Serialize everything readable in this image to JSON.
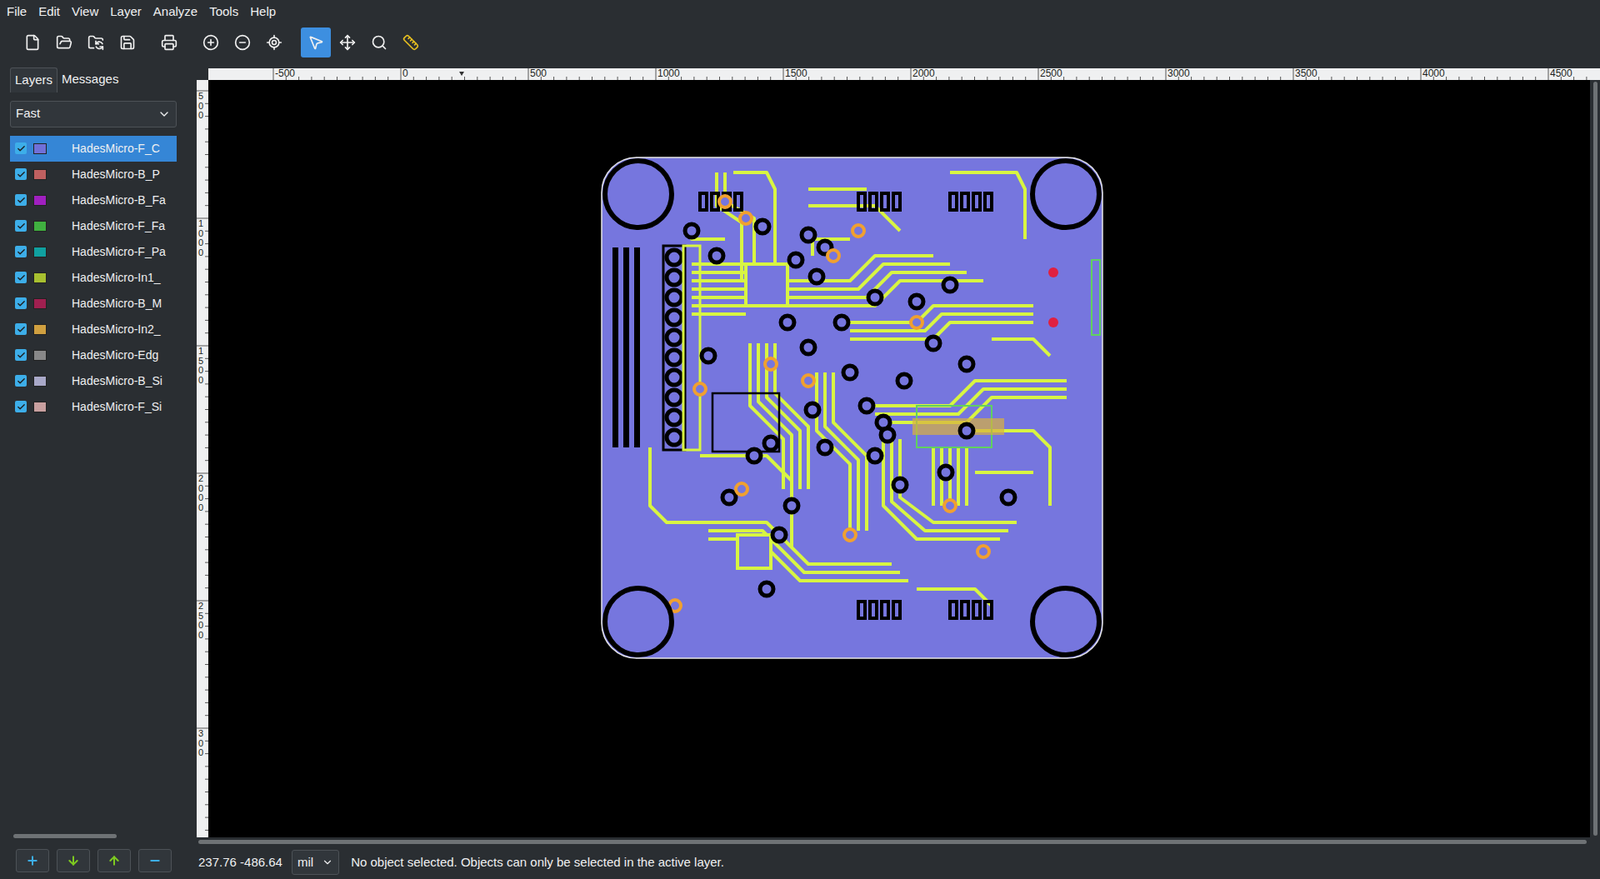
{
  "window": {
    "title": "gerbv"
  },
  "menu": [
    "File",
    "Edit",
    "View",
    "Layer",
    "Analyze",
    "Tools",
    "Help"
  ],
  "toolbar": [
    {
      "kind": "new",
      "selected": false
    },
    {
      "kind": "open",
      "selected": false
    },
    {
      "kind": "revert",
      "selected": false
    },
    {
      "kind": "save",
      "selected": false
    },
    {
      "kind": "print",
      "selected": false
    },
    {
      "kind": "zoom-in",
      "selected": false
    },
    {
      "kind": "zoom-out",
      "selected": false
    },
    {
      "kind": "zoom-fit",
      "selected": false
    },
    {
      "kind": "pointer",
      "selected": true
    },
    {
      "kind": "pan",
      "selected": false
    },
    {
      "kind": "zoom",
      "selected": false
    },
    {
      "kind": "measure",
      "selected": false
    }
  ],
  "sidebar": {
    "tabs": [
      {
        "label": "Layers",
        "selected": true
      },
      {
        "label": "Messages",
        "selected": false
      }
    ],
    "render_mode": "Fast",
    "layers": [
      {
        "name": "HadesMicro-F_C",
        "visible": true,
        "selected": true,
        "color": "#7070d8"
      },
      {
        "name": "HadesMicro-B_P",
        "visible": true,
        "selected": false,
        "color": "#c06060"
      },
      {
        "name": "HadesMicro-B_Fa",
        "visible": true,
        "selected": false,
        "color": "#a020c0"
      },
      {
        "name": "HadesMicro-F_Fa",
        "visible": true,
        "selected": false,
        "color": "#40b040"
      },
      {
        "name": "HadesMicro-F_Pa",
        "visible": true,
        "selected": false,
        "color": "#10a0a0"
      },
      {
        "name": "HadesMicro-In1_",
        "visible": true,
        "selected": false,
        "color": "#a8c030"
      },
      {
        "name": "HadesMicro-B_M",
        "visible": true,
        "selected": false,
        "color": "#a02050"
      },
      {
        "name": "HadesMicro-In2_",
        "visible": true,
        "selected": false,
        "color": "#d0a040"
      },
      {
        "name": "HadesMicro-Edg",
        "visible": true,
        "selected": false,
        "color": "#888888"
      },
      {
        "name": "HadesMicro-B_Si",
        "visible": true,
        "selected": false,
        "color": "#a8a8c8"
      },
      {
        "name": "HadesMicro-F_Si",
        "visible": true,
        "selected": false,
        "color": "#c8a0a0"
      }
    ],
    "buttons": [
      {
        "kind": "add"
      },
      {
        "kind": "down"
      },
      {
        "kind": "up"
      },
      {
        "kind": "remove"
      }
    ]
  },
  "ruler": {
    "top": [
      "-500",
      "0",
      "500",
      "1000",
      "1500",
      "2000",
      "2500",
      "3000",
      "3500",
      "4000",
      "4500"
    ],
    "left": [
      "500",
      "1000",
      "1500",
      "2000",
      "2500",
      "300"
    ]
  },
  "status_bar": {
    "coords": "237.76 -486.64",
    "units": "mil",
    "message": "No object selected. Objects can only be selected in the active layer."
  }
}
